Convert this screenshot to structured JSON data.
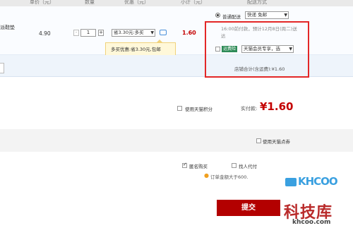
{
  "header": {
    "col_price": "单价（元）",
    "col_qty": "数量",
    "col_discount": "优惠（元）",
    "col_subtotal": "小计（元）",
    "col_shipping": "配送方式"
  },
  "item": {
    "name_fragment": "派鞋垫",
    "unit_price": "4.90",
    "quantity": "1",
    "minus": "-",
    "plus": "+",
    "discount_select": "省3.30元:多买",
    "subtotal": "1.60",
    "tooltip": "多买优惠:省3.30元,包邮"
  },
  "shipping": {
    "method_label": "普通配送",
    "method_select": "快递 免邮",
    "delivery_note": "16:00前付款，预计12月8日(周二)送达",
    "freight_insurance_label": "运费险",
    "member_select": "天猫会员专享，选",
    "store_total_label": "店铺合计(含运费):",
    "store_total_value": "¥1.60"
  },
  "summary": {
    "tmall_points_label": "使用天猫积分",
    "paid_label": "实付款:",
    "paid_value": "¥1.60",
    "tmall_coupon_label": "使用天猫点券",
    "anonymous_label": "匿名购买",
    "proxy_pay_label": "找人代付",
    "order_notice": "订单金额大于600.",
    "submit_label": "提交"
  },
  "watermark": {
    "logo_text": "KHCOO",
    "name": "科技库",
    "url": "khcoo.com"
  }
}
